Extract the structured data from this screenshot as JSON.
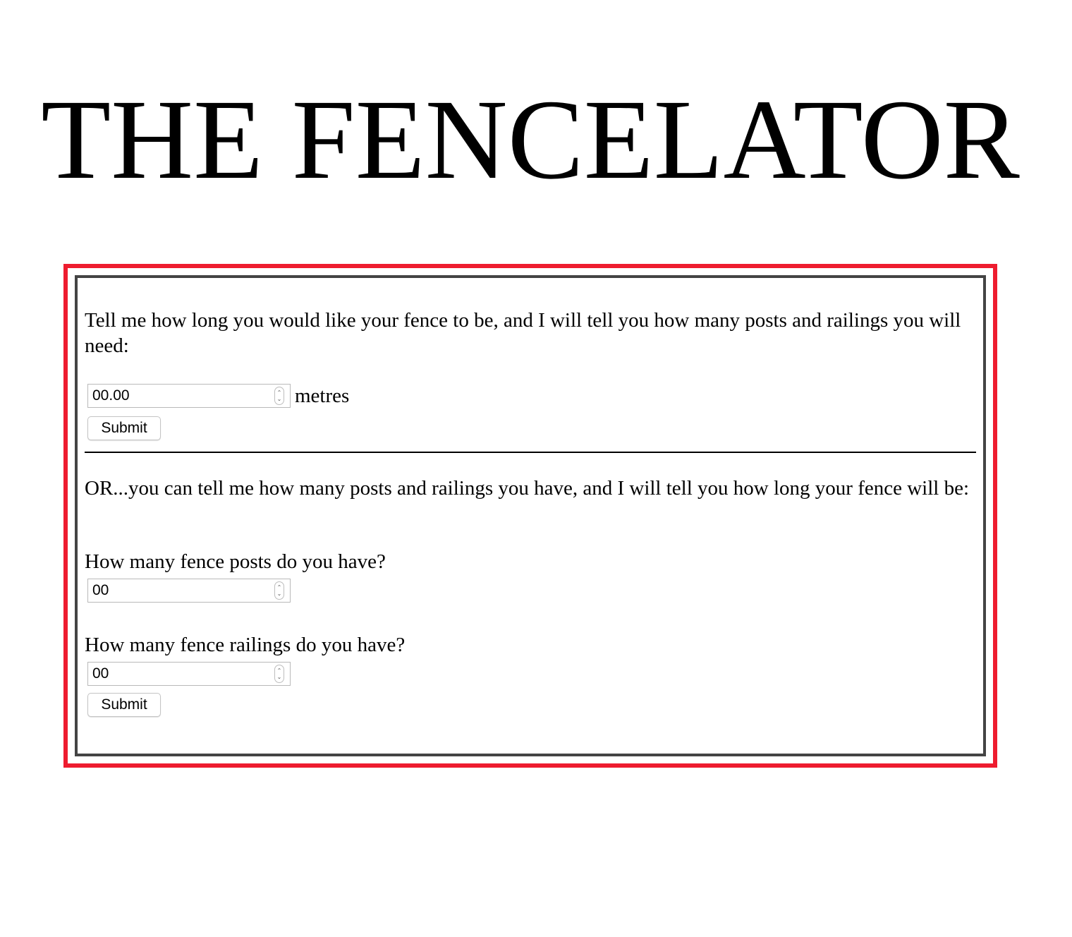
{
  "page": {
    "title": "THE FENCELATOR"
  },
  "length_form": {
    "instructions": "Tell me how long you would like your fence to be, and I will tell you how many posts and railings you will need:",
    "length_value": "00.00",
    "unit_label": "metres",
    "submit_label": "Submit"
  },
  "parts_form": {
    "instructions": "OR...you can tell me how many posts and railings you have, and I will tell you how long your fence will be:",
    "posts_label": "How many fence posts do you have?",
    "posts_value": "00",
    "railings_label": "How many fence railings do you have?",
    "railings_value": "00",
    "submit_label": "Submit"
  },
  "colors": {
    "outer_border": "#ee1c2f",
    "inner_border": "#444444"
  },
  "icons": {
    "spinner": "up-down-stepper-icon"
  }
}
